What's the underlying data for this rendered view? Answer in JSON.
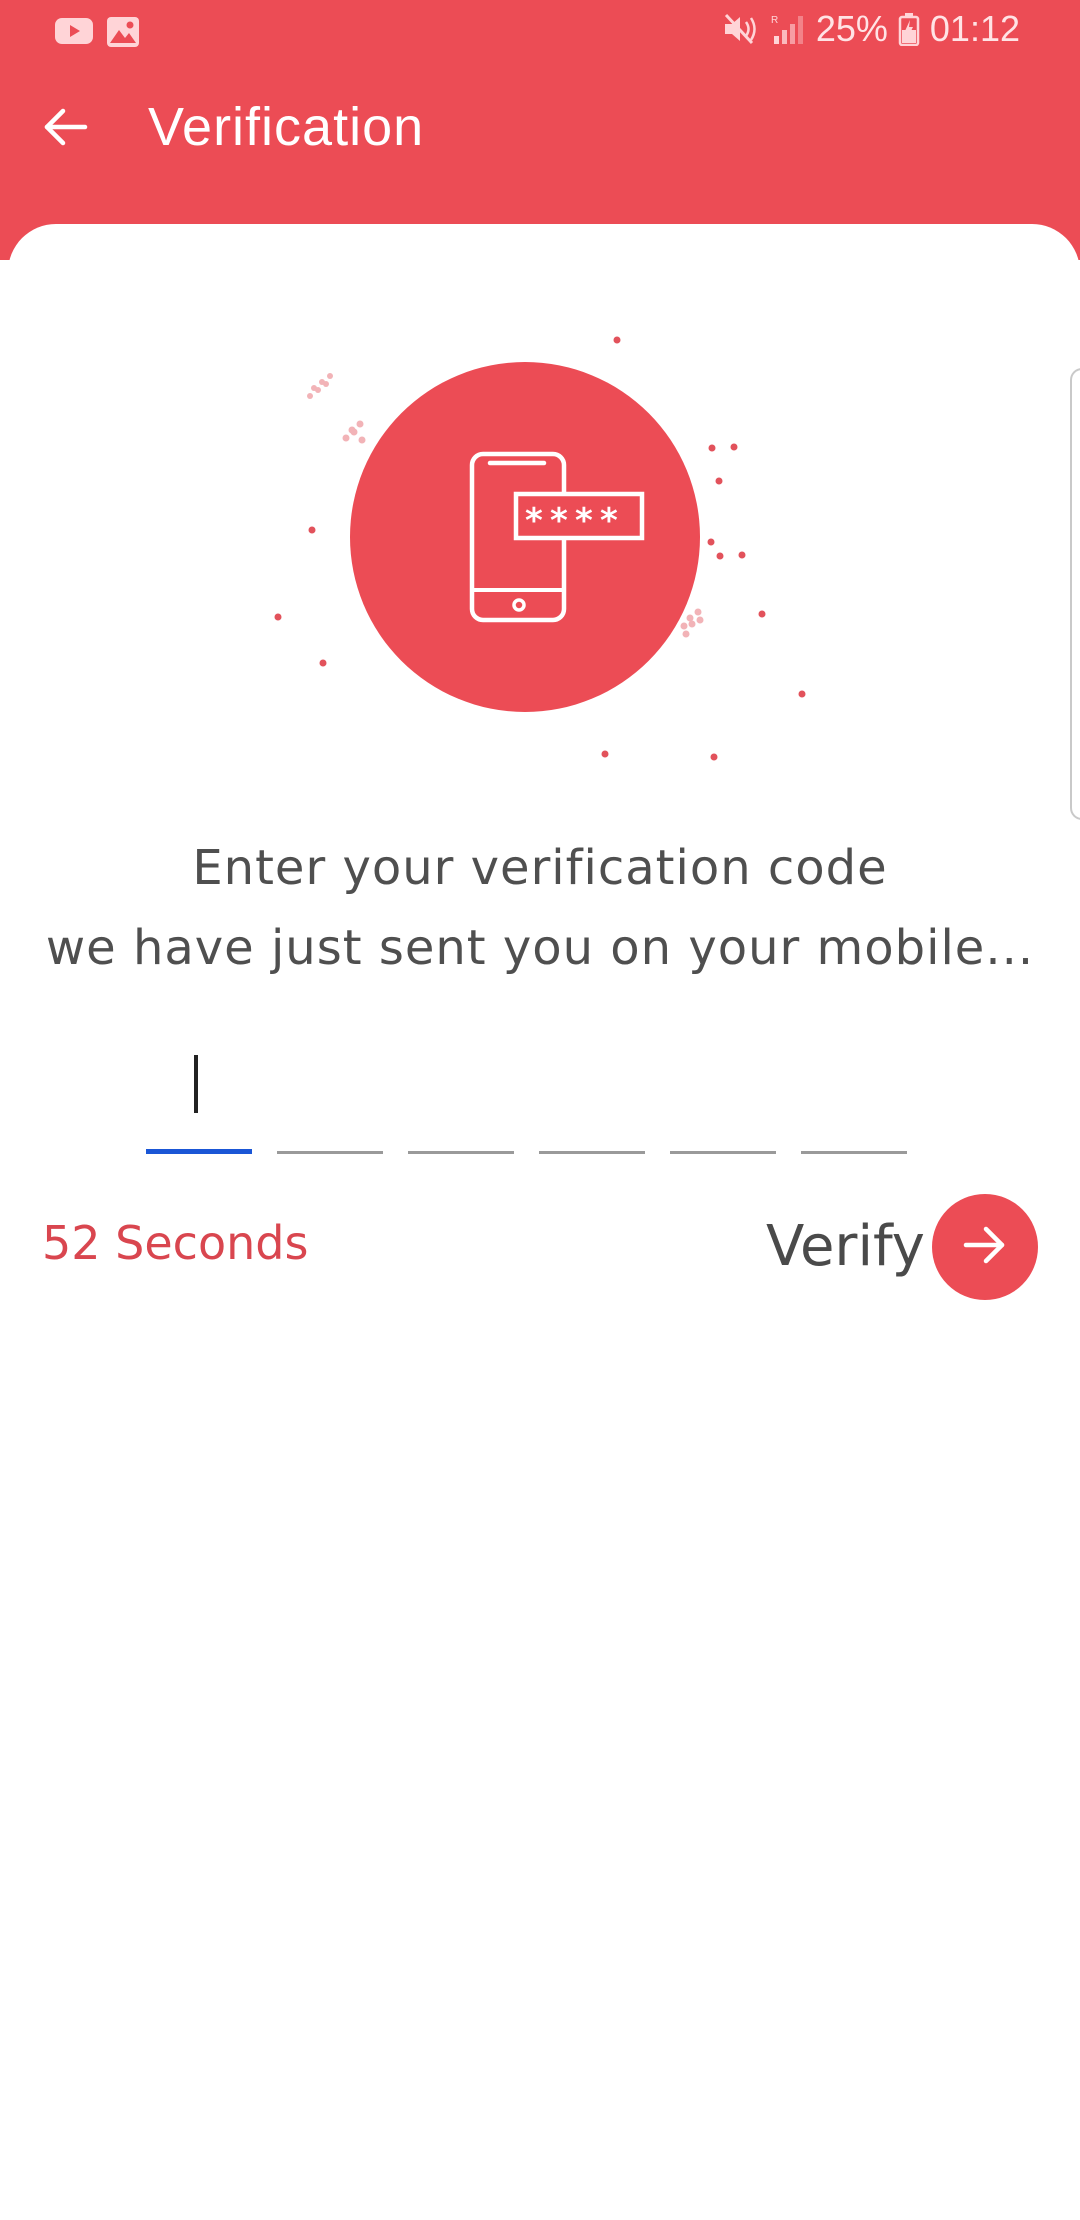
{
  "status_bar": {
    "left_icons": [
      "youtube-icon",
      "gallery-icon"
    ],
    "right_icons": [
      "mute-icon",
      "signal-icon",
      "battery-charging-icon"
    ],
    "battery": "25%",
    "time": "01:12"
  },
  "app_bar": {
    "back_icon": "arrow-left-icon",
    "title": "Verification"
  },
  "illustration": {
    "icon": "phone-password-icon",
    "masked_code": "****",
    "accent_color": "#ec4c55"
  },
  "instructions": {
    "line1": "Enter your verification code",
    "line2": "we have just sent you on your mobile..."
  },
  "otp": {
    "length": 6,
    "values": [
      "",
      "",
      "",
      "",
      "",
      ""
    ],
    "active_index": 0,
    "active_color": "#1a56d6"
  },
  "timer": {
    "text": "52 Seconds"
  },
  "verify": {
    "label": "Verify",
    "icon": "arrow-right-icon"
  },
  "colors": {
    "primary": "#ec4c55",
    "text": "#4f4f4f",
    "timer": "#d9464f"
  }
}
